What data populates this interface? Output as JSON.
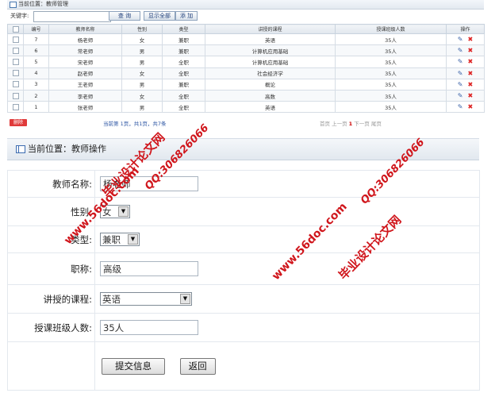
{
  "top_breadcrumb": "当前位置：教师管理",
  "search": {
    "label": "关键字:",
    "value": "",
    "search_button": "查 询",
    "show_all_button": "显示全部",
    "add_button": "添 加"
  },
  "table": {
    "headers": [
      "编号",
      "教师名称",
      "性别",
      "类型",
      "讲授的课程",
      "授课班级人数",
      "操作"
    ],
    "rows": [
      [
        "7",
        "杨老师",
        "女",
        "兼职",
        "英语",
        "35人"
      ],
      [
        "6",
        "常老师",
        "男",
        "兼职",
        "计算机应用基础",
        "35人"
      ],
      [
        "5",
        "宋老师",
        "男",
        "全职",
        "计算机应用基础",
        "35人"
      ],
      [
        "4",
        "赵老师",
        "女",
        "全职",
        "社会经济学",
        "35人"
      ],
      [
        "3",
        "王老师",
        "男",
        "兼职",
        "概论",
        "35人"
      ],
      [
        "2",
        "李老师",
        "女",
        "全职",
        "高数",
        "35人"
      ],
      [
        "1",
        "张老师",
        "男",
        "全职",
        "英语",
        "35人"
      ]
    ]
  },
  "delete_button": "删除",
  "page_info": "当前第 1页，共1页，共7条",
  "pagination": {
    "first": "首页",
    "prev": "上一页",
    "current": "1",
    "next": "下一页",
    "last": "尾页"
  },
  "form_breadcrumb": "当前位置：教师操作",
  "form": {
    "name_label": "教师名称:",
    "name_value": "杨老师",
    "gender_label": "性别:",
    "gender_value": "女",
    "type_label": "类型:",
    "type_value": "兼职",
    "title_label": "职称:",
    "title_value": "高级",
    "course_label": "讲授的课程:",
    "course_value": "英语",
    "class_size_label": "授课班级人数:",
    "class_size_value": "35人",
    "submit_button": "提交信息",
    "back_button": "返回"
  },
  "watermarks": [
    "毕业设计论文网",
    "www.56doc.com",
    "QQ:306826066",
    "QQ:306826066",
    "www.56doc.com",
    "毕业设计论文网"
  ],
  "colors": {
    "accent_blue": "#2b54a3",
    "delete_red": "#e03a3a",
    "watermark_red": "#d0161c"
  }
}
